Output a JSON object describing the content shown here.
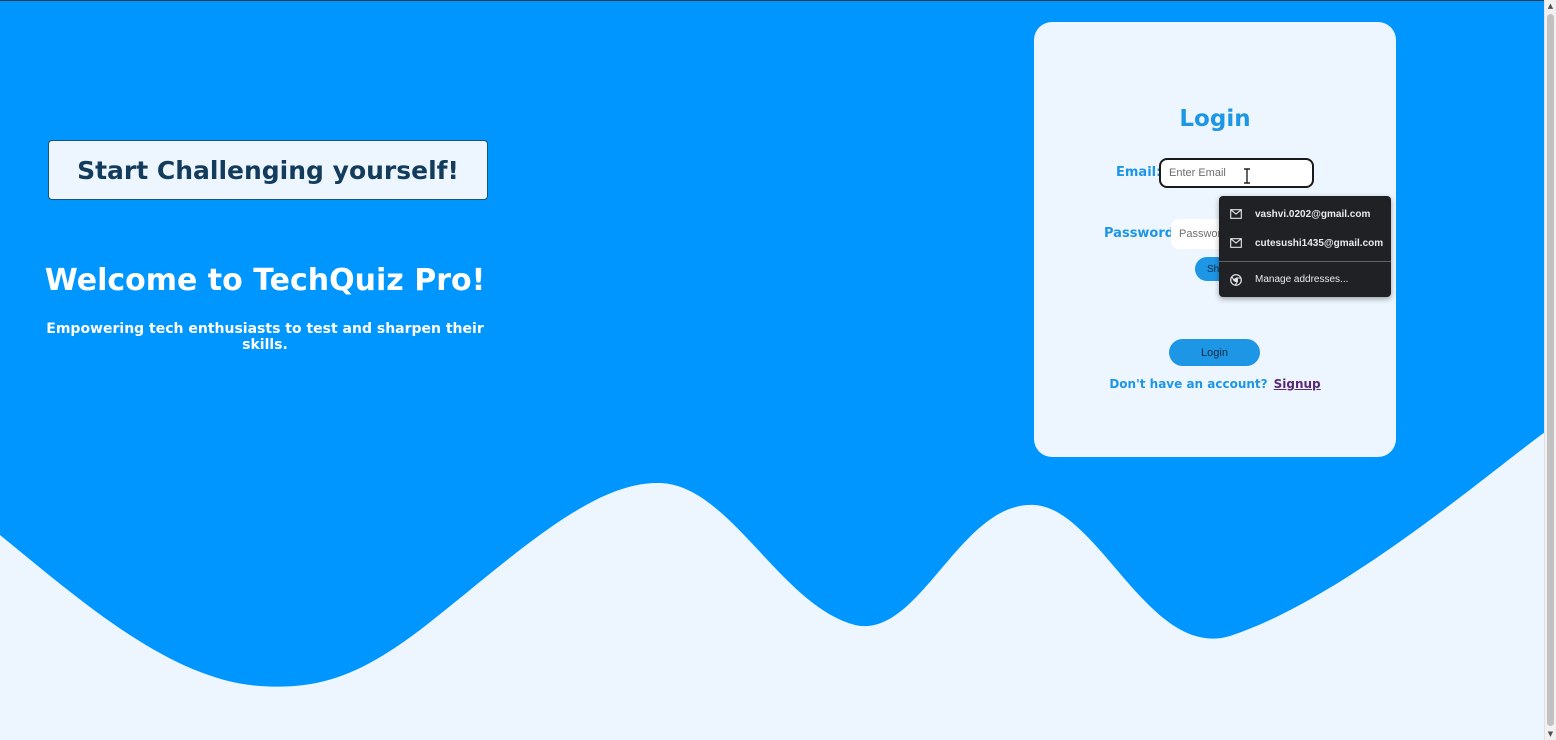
{
  "hero": {
    "challenge_button": "Start Challenging yourself!",
    "title": "Welcome to TechQuiz Pro!",
    "subtitle": "Empowering tech enthusiasts to test and sharpen their skills."
  },
  "login": {
    "title": "Login",
    "email_label": "Email:",
    "email_placeholder": "Enter Email",
    "password_label": "Password:",
    "password_placeholder": "Password",
    "show_button": "Show",
    "login_button": "Login",
    "signup_prompt": "Don't have an account?",
    "signup_link": "Signup"
  },
  "autofill": {
    "suggestions": [
      "vashvi.0202@gmail.com",
      "cutesushi1435@gmail.com"
    ],
    "manage_label": "Manage addresses..."
  },
  "colors": {
    "primary_blue": "#0096ff",
    "light_bg": "#edf6fe",
    "accent_text": "#1e96e6",
    "dropdown_bg": "#202124"
  }
}
